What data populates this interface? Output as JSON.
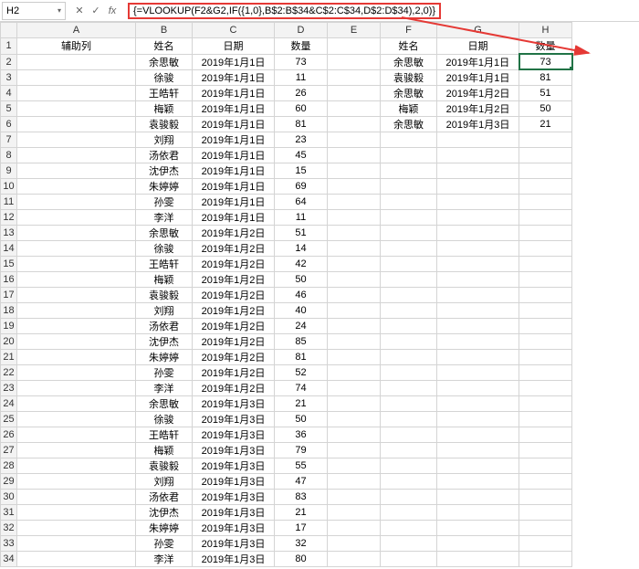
{
  "formulaBar": {
    "cellRef": "H2",
    "cancel": "✕",
    "confirm": "✓",
    "fx": "fx",
    "formula": "{=VLOOKUP(F2&G2,IF({1,0},B$2:B$34&C$2:C$34,D$2:D$34),2,0)}"
  },
  "columns": [
    "A",
    "B",
    "C",
    "D",
    "E",
    "F",
    "G",
    "H"
  ],
  "headersRow": {
    "A": "辅助列",
    "B": "姓名",
    "C": "日期",
    "D": "数量",
    "E": "",
    "F": "姓名",
    "G": "日期",
    "H": "数量"
  },
  "leftTable": [
    {
      "B": "余思敏",
      "C": "2019年1月1日",
      "D": "73"
    },
    {
      "B": "徐骏",
      "C": "2019年1月1日",
      "D": "11"
    },
    {
      "B": "王皓轩",
      "C": "2019年1月1日",
      "D": "26"
    },
    {
      "B": "梅颖",
      "C": "2019年1月1日",
      "D": "60"
    },
    {
      "B": "袁骏毅",
      "C": "2019年1月1日",
      "D": "81"
    },
    {
      "B": "刘翔",
      "C": "2019年1月1日",
      "D": "23"
    },
    {
      "B": "汤依君",
      "C": "2019年1月1日",
      "D": "45"
    },
    {
      "B": "沈伊杰",
      "C": "2019年1月1日",
      "D": "15"
    },
    {
      "B": "朱婷婷",
      "C": "2019年1月1日",
      "D": "69"
    },
    {
      "B": "孙雯",
      "C": "2019年1月1日",
      "D": "64"
    },
    {
      "B": "李洋",
      "C": "2019年1月1日",
      "D": "11"
    },
    {
      "B": "余思敏",
      "C": "2019年1月2日",
      "D": "51"
    },
    {
      "B": "徐骏",
      "C": "2019年1月2日",
      "D": "14"
    },
    {
      "B": "王皓轩",
      "C": "2019年1月2日",
      "D": "42"
    },
    {
      "B": "梅颖",
      "C": "2019年1月2日",
      "D": "50"
    },
    {
      "B": "袁骏毅",
      "C": "2019年1月2日",
      "D": "46"
    },
    {
      "B": "刘翔",
      "C": "2019年1月2日",
      "D": "40"
    },
    {
      "B": "汤依君",
      "C": "2019年1月2日",
      "D": "24"
    },
    {
      "B": "沈伊杰",
      "C": "2019年1月2日",
      "D": "85"
    },
    {
      "B": "朱婷婷",
      "C": "2019年1月2日",
      "D": "81"
    },
    {
      "B": "孙雯",
      "C": "2019年1月2日",
      "D": "52"
    },
    {
      "B": "李洋",
      "C": "2019年1月2日",
      "D": "74"
    },
    {
      "B": "余思敏",
      "C": "2019年1月3日",
      "D": "21"
    },
    {
      "B": "徐骏",
      "C": "2019年1月3日",
      "D": "50"
    },
    {
      "B": "王皓轩",
      "C": "2019年1月3日",
      "D": "36"
    },
    {
      "B": "梅颖",
      "C": "2019年1月3日",
      "D": "79"
    },
    {
      "B": "袁骏毅",
      "C": "2019年1月3日",
      "D": "55"
    },
    {
      "B": "刘翔",
      "C": "2019年1月3日",
      "D": "47"
    },
    {
      "B": "汤依君",
      "C": "2019年1月3日",
      "D": "83"
    },
    {
      "B": "沈伊杰",
      "C": "2019年1月3日",
      "D": "21"
    },
    {
      "B": "朱婷婷",
      "C": "2019年1月3日",
      "D": "17"
    },
    {
      "B": "孙雯",
      "C": "2019年1月3日",
      "D": "32"
    },
    {
      "B": "李洋",
      "C": "2019年1月3日",
      "D": "80"
    }
  ],
  "rightTable": [
    {
      "F": "余思敏",
      "G": "2019年1月1日",
      "H": "73"
    },
    {
      "F": "袁骏毅",
      "G": "2019年1月1日",
      "H": "81"
    },
    {
      "F": "余思敏",
      "G": "2019年1月2日",
      "H": "51"
    },
    {
      "F": "梅颖",
      "G": "2019年1月2日",
      "H": "50"
    },
    {
      "F": "余思敏",
      "G": "2019年1月3日",
      "H": "21"
    }
  ],
  "chart_data": {
    "type": "table",
    "note": "Spreadsheet data — left block rows 2-34 cols B-D, right lookup block rows 2-6 cols F-H; formula in H2 performs multi-key VLOOKUP"
  }
}
